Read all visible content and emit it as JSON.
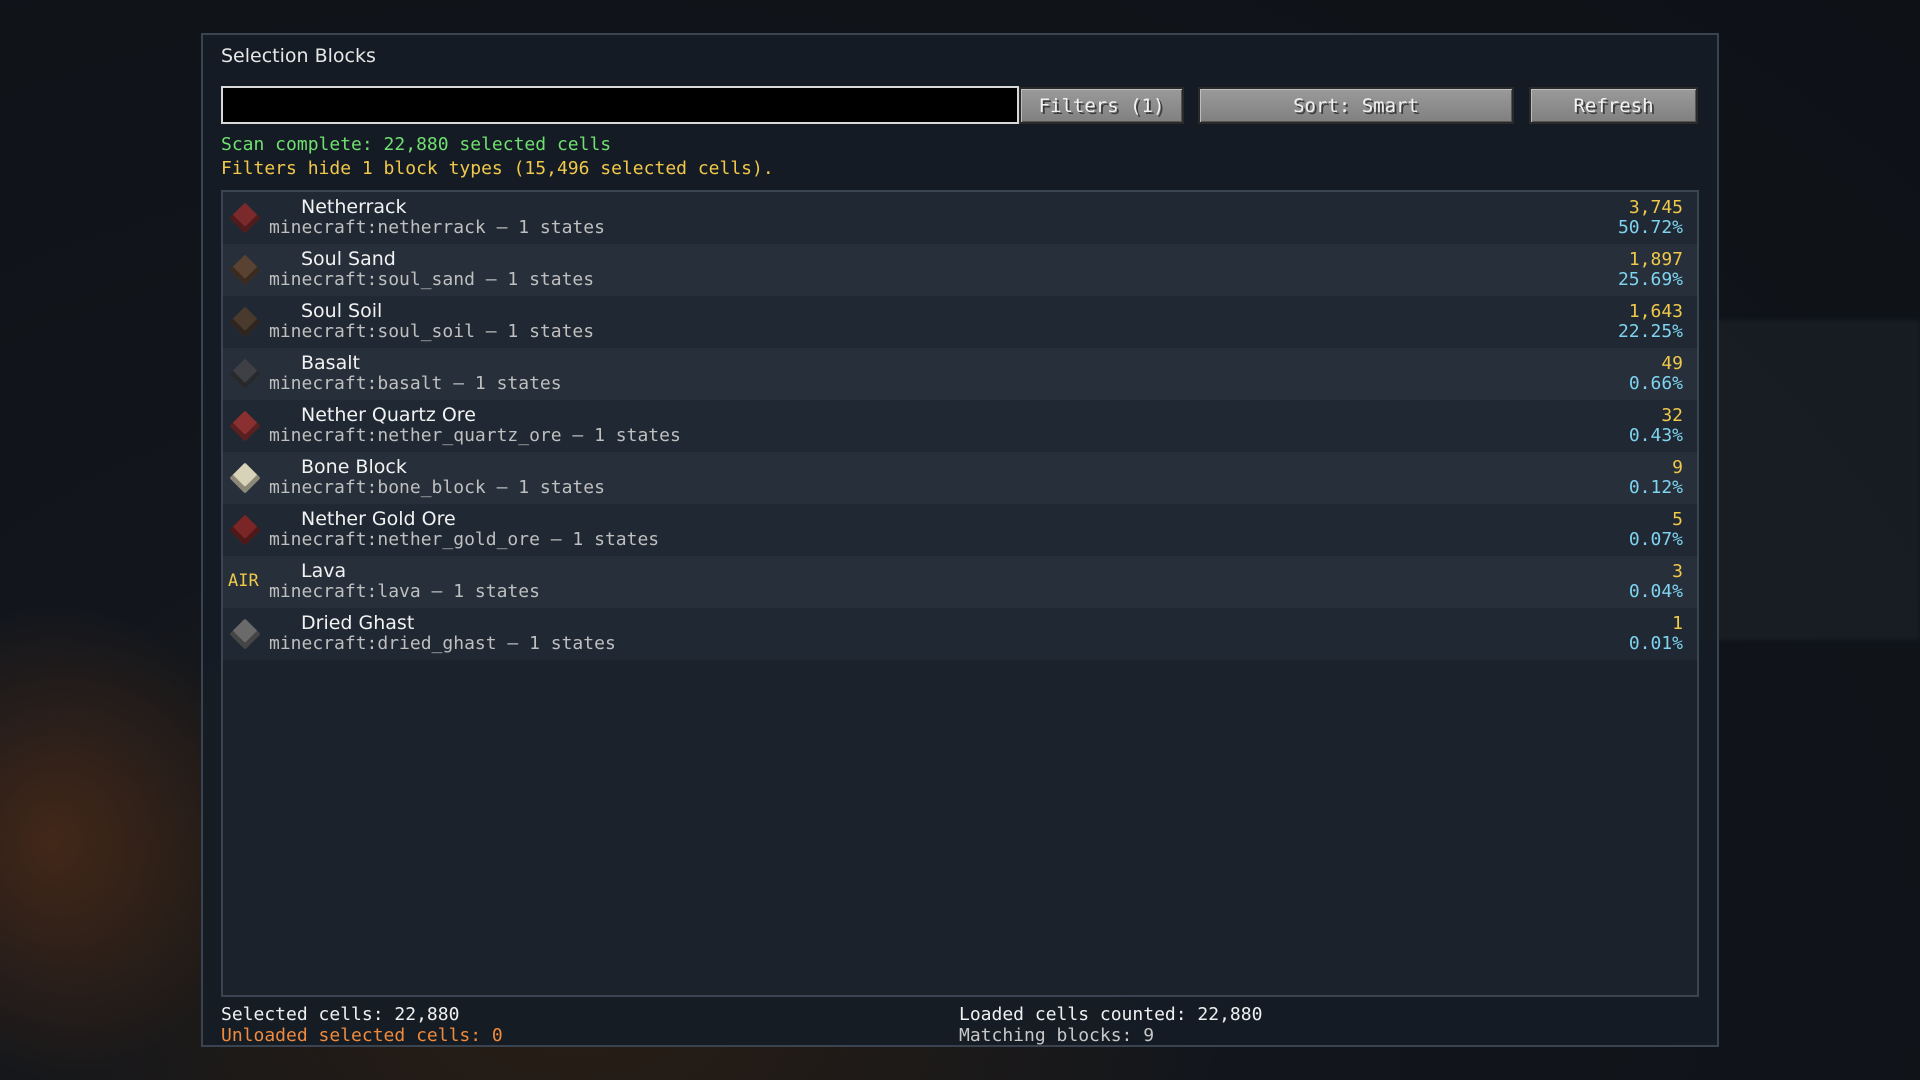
{
  "title": "Selection Blocks",
  "search": {
    "value": "",
    "placeholder": ""
  },
  "buttons": {
    "filters": "Filters (1)",
    "sort": "Sort: Smart",
    "refresh": "Refresh"
  },
  "status": {
    "scan": "Scan complete: 22,880 selected cells",
    "filters": "Filters hide 1 block types (15,496 selected cells)."
  },
  "rows": [
    {
      "name": "Netherrack",
      "id": "minecraft:netherrack  –  1 states",
      "count": "3,745",
      "pct": "50.72%",
      "icon": "netherrack-icon",
      "color": "#7a2a2a"
    },
    {
      "name": "Soul Sand",
      "id": "minecraft:soul_sand  –  1 states",
      "count": "1,897",
      "pct": "25.69%",
      "icon": "soul-sand-icon",
      "color": "#5a4232"
    },
    {
      "name": "Soul Soil",
      "id": "minecraft:soul_soil  –  1 states",
      "count": "1,643",
      "pct": "22.25%",
      "icon": "soul-soil-icon",
      "color": "#4a3a2e"
    },
    {
      "name": "Basalt",
      "id": "minecraft:basalt  –  1 states",
      "count": "49",
      "pct": "0.66%",
      "icon": "basalt-icon",
      "color": "#3e4046"
    },
    {
      "name": "Nether Quartz Ore",
      "id": "minecraft:nether_quartz_ore  –  1 states",
      "count": "32",
      "pct": "0.43%",
      "icon": "nether-quartz-ore-icon",
      "color": "#8a3030"
    },
    {
      "name": "Bone Block",
      "id": "minecraft:bone_block  –  1 states",
      "count": "9",
      "pct": "0.12%",
      "icon": "bone-block-icon",
      "color": "#d8d2b8"
    },
    {
      "name": "Nether Gold Ore",
      "id": "minecraft:nether_gold_ore  –  1 states",
      "count": "5",
      "pct": "0.07%",
      "icon": "nether-gold-ore-icon",
      "color": "#7a2626"
    },
    {
      "name": "Lava",
      "id": "minecraft:lava  –  1 states",
      "count": "3",
      "pct": "0.04%",
      "icon": "air-text-icon",
      "iconText": "AIR",
      "color": "#f0c84a"
    },
    {
      "name": "Dried Ghast",
      "id": "minecraft:dried_ghast  –  1 states",
      "count": "1",
      "pct": "0.01%",
      "icon": "dried-ghast-icon",
      "color": "#6a6a6a"
    }
  ],
  "footer": {
    "selected": "Selected cells: 22,880",
    "unloaded": "Unloaded selected cells: 0",
    "loaded": "Loaded cells counted: 22,880",
    "matching": "Matching blocks: 9"
  }
}
